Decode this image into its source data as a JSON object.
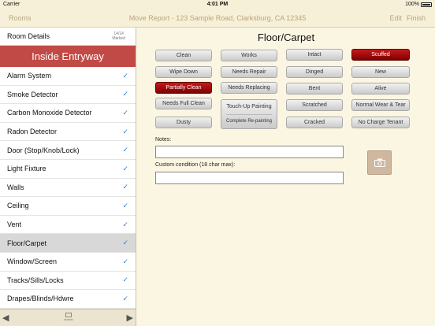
{
  "status": {
    "carrier": "Carrier",
    "time": "4:01 PM",
    "battery": "100%"
  },
  "nav": {
    "back": "Rooms",
    "title": "Move Report - 123 Sample Road, Clarksburg, CA 12345",
    "edit": "Edit",
    "finish": "Finish"
  },
  "sidebar": {
    "header": {
      "label": "Room Details",
      "count": "14/14",
      "marked": "Marked"
    },
    "section": "Inside Entryway",
    "items": [
      {
        "label": "Alarm System",
        "checked": true
      },
      {
        "label": "Smoke Detector",
        "checked": true
      },
      {
        "label": "Carbon Monoxide Detector",
        "checked": true
      },
      {
        "label": "Radon Detector",
        "checked": true
      },
      {
        "label": "Door (Stop/Knob/Lock)",
        "checked": true
      },
      {
        "label": "Light Fixture",
        "checked": true
      },
      {
        "label": "Walls",
        "checked": true
      },
      {
        "label": "Ceiling",
        "checked": true
      },
      {
        "label": "Vent",
        "checked": true
      },
      {
        "label": "Floor/Carpet",
        "checked": true,
        "selected": true
      },
      {
        "label": "Window/Screen",
        "checked": true
      },
      {
        "label": "Tracks/Sills/Locks",
        "checked": true
      },
      {
        "label": "Drapes/Blinds/Hdwre",
        "checked": true
      }
    ],
    "checkmark": "✓",
    "toolbar": {
      "rooms_label": "ROOMS",
      "prev_icon": "triangle-left",
      "next_icon": "triangle-right"
    }
  },
  "main": {
    "title": "Floor/Carpet",
    "buttons": {
      "clean": "Clean",
      "wipe_down": "Wipe Down",
      "partially_clean": "Partially Clean",
      "needs_full_clean": "Needs Full Clean",
      "dusty": "Dusty",
      "works": "Works",
      "needs_repair": "Needs Repair",
      "needs_replacing": "Needs Replacing",
      "touch_up_painting": "Touch-Up Painting",
      "complete_repainting": "Complete Re-painting",
      "intact": "Intact",
      "dinged": "Dinged",
      "bent": "Bent",
      "scratched": "Scratched",
      "cracked": "Cracked",
      "scuffed": "Scuffed",
      "new": "New",
      "alive": "Alive",
      "normal_wear": "Normal Wear & Tear",
      "no_charge_tenant": "No Charge Tenant"
    },
    "notes_label": "Notes:",
    "notes_value": "",
    "custom_label": "Custom condition (18 char max):",
    "custom_value": "",
    "camera_icon": "camera-icon"
  },
  "colors": {
    "active": "#a00d0d",
    "section": "#c24a46",
    "background": "#fbf6e2",
    "nav_text": "#b8a57a",
    "check": "#2d7fd4"
  }
}
